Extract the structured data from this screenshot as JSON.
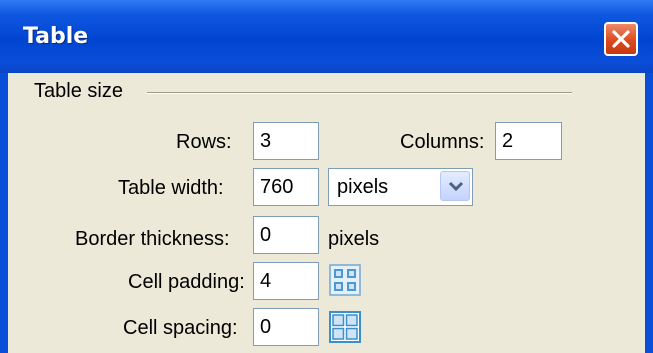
{
  "window": {
    "title": "Table"
  },
  "table_size": {
    "group_label": "Table size",
    "rows": {
      "label": "Rows:",
      "value": "3"
    },
    "columns": {
      "label": "Columns:",
      "value": "2"
    },
    "table_width": {
      "label": "Table width:",
      "value": "760",
      "unit": "pixels"
    },
    "border_thickness": {
      "label": "Border thickness:",
      "value": "0",
      "unit": "pixels"
    },
    "cell_padding": {
      "label": "Cell padding:",
      "value": "4"
    },
    "cell_spacing": {
      "label": "Cell spacing:",
      "value": "0"
    }
  },
  "icons": {
    "close": "close-icon",
    "dropdown": "chevron-down-icon",
    "cell_padding": "cell-padding-icon",
    "cell_spacing": "cell-spacing-icon"
  },
  "colors": {
    "titlebar": "#0045d0",
    "dialog_face": "#ece9d8",
    "close_button": "#dc4a1e",
    "field_border": "#7f9db9",
    "icon_accent": "#3a8fcf"
  }
}
